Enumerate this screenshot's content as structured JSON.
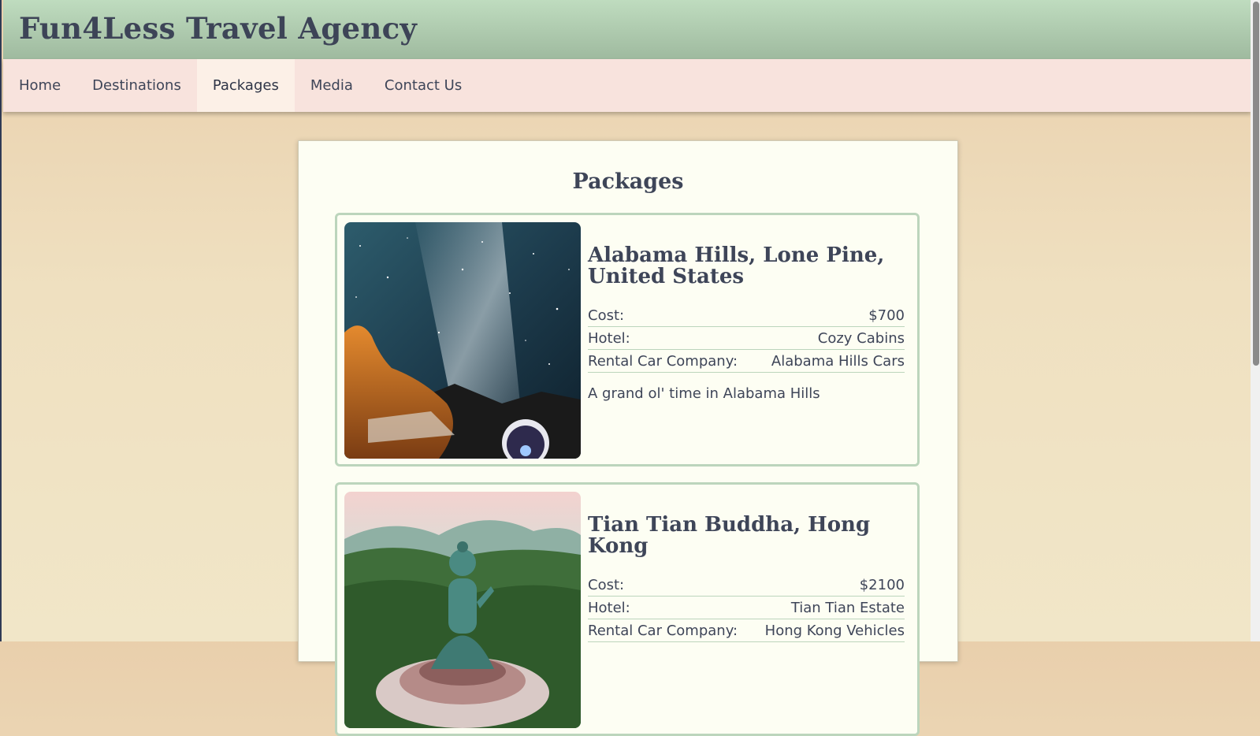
{
  "header": {
    "title": "Fun4Less Travel Agency"
  },
  "nav": {
    "items": [
      {
        "label": "Home"
      },
      {
        "label": "Destinations"
      },
      {
        "label": "Packages",
        "active": true
      },
      {
        "label": "Media"
      },
      {
        "label": "Contact Us"
      }
    ]
  },
  "main": {
    "title": "Packages",
    "packages": [
      {
        "name": "Alabama Hills, Lone Pine, United States",
        "cost_label": "Cost:",
        "cost": "$700",
        "hotel_label": "Hotel:",
        "hotel": "Cozy Cabins",
        "car_label": "Rental Car Company:",
        "car": "Alabama Hills Cars",
        "description": "A grand ol' time in Alabama Hills"
      },
      {
        "name": "Tian Tian Buddha, Hong Kong",
        "cost_label": "Cost:",
        "cost": "$2100",
        "hotel_label": "Hotel:",
        "hotel": "Tian Tian Estate",
        "car_label": "Rental Car Company:",
        "car": "Hong Kong Vehicles"
      }
    ]
  },
  "colors": {
    "header_green": "#a9c7a9",
    "nav_pink": "#f8e3dd",
    "card_bg": "#fdfef3",
    "text": "#3e4558",
    "border_green": "#bcd5bc"
  }
}
